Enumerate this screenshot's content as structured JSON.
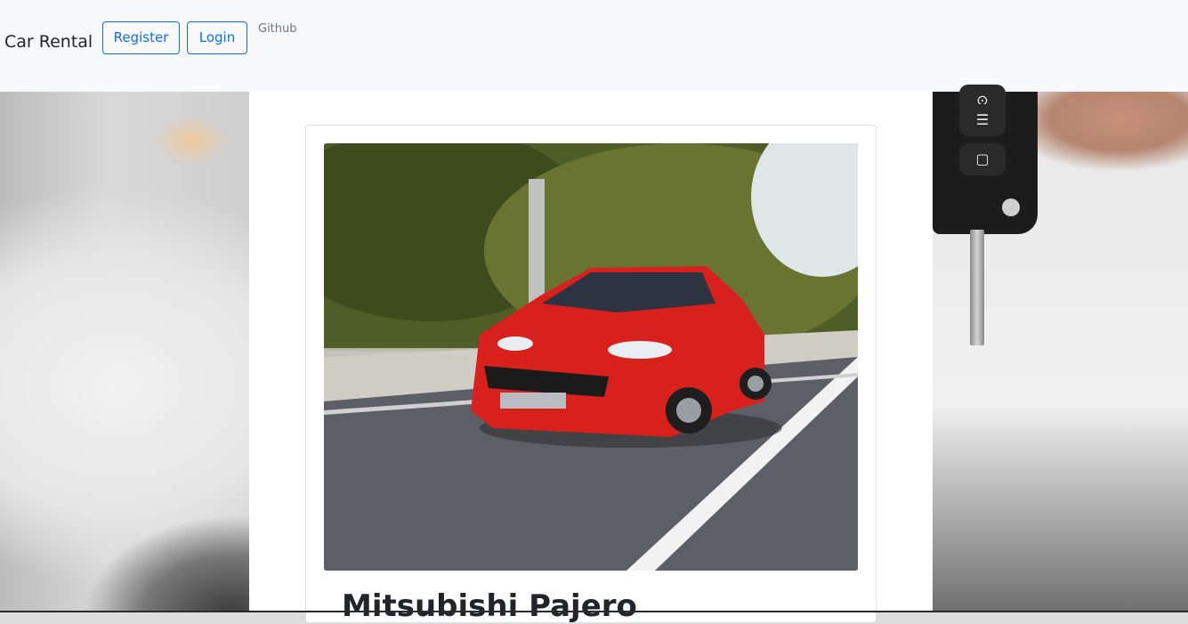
{
  "navbar": {
    "brand": "Car Rental",
    "register_label": "Register",
    "login_label": "Login",
    "github_label": "Github"
  },
  "card": {
    "image_alt": "red-hatchback-car-on-road",
    "title": "Mitsubishi Pajero"
  },
  "colors": {
    "navbar_bg": "#f8f9fa",
    "button_primary": "#0d6efd",
    "link_muted": "#6c757d",
    "car_red": "#d8201c"
  }
}
